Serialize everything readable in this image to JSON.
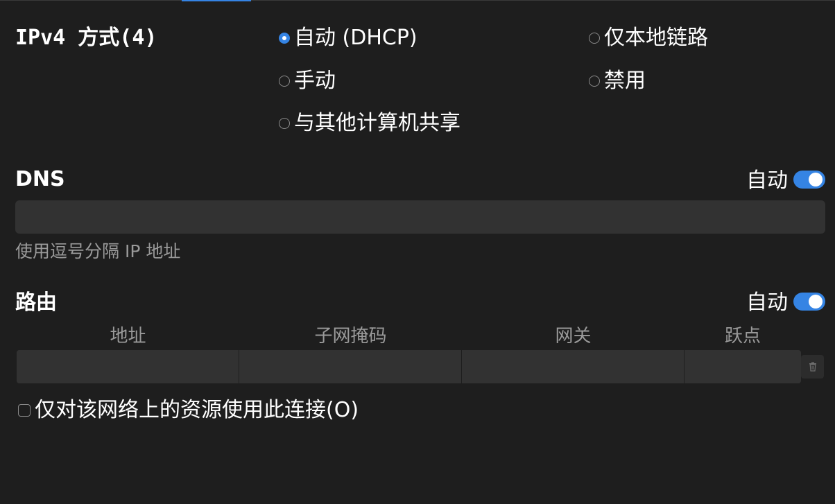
{
  "ipv4": {
    "title": "IPv4 方式(4)",
    "options": [
      {
        "label": "自动 (DHCP)",
        "checked": true
      },
      {
        "label": "仅本地链路",
        "checked": false
      },
      {
        "label": "手动",
        "checked": false
      },
      {
        "label": "禁用",
        "checked": false
      },
      {
        "label": "与其他计算机共享",
        "checked": false
      }
    ]
  },
  "dns": {
    "title": "DNS",
    "auto_label": "自动",
    "auto_enabled": true,
    "value": "",
    "hint": "使用逗号分隔 IP 地址"
  },
  "routes": {
    "title": "路由",
    "auto_label": "自动",
    "auto_enabled": true,
    "columns": [
      "地址",
      "子网掩码",
      "网关",
      "跃点"
    ],
    "rows": [
      {
        "address": "",
        "netmask": "",
        "gateway": "",
        "metric": ""
      }
    ],
    "delete_icon": "trash-icon"
  },
  "only_resources": {
    "label": "仅对该网络上的资源使用此连接(O)",
    "checked": false
  },
  "colors": {
    "accent": "#3584e4",
    "background": "#1e1e1e",
    "input_bg": "#323232"
  }
}
